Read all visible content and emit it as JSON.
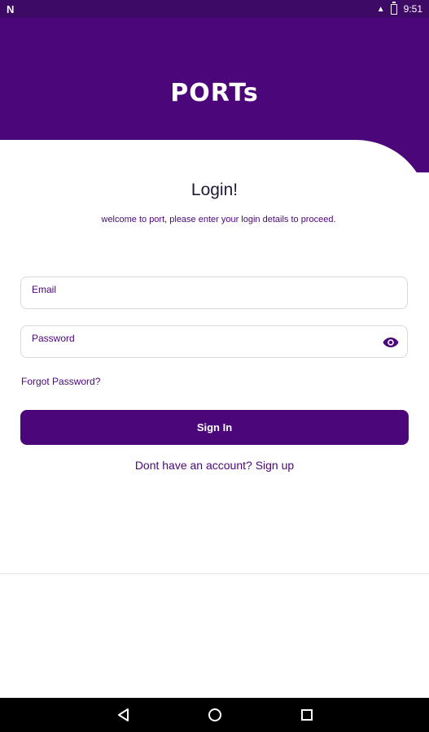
{
  "status_bar": {
    "left_icon": "N",
    "signal": "▲",
    "time": "9:51"
  },
  "header": {
    "logo_text": "PORTs"
  },
  "login": {
    "title": "Login!",
    "subtitle": "welcome to port, please enter your login details to proceed.",
    "email_placeholder": "Email",
    "password_placeholder": "Password",
    "forgot_password": "Forgot Password?",
    "signin_label": "Sign In",
    "signup_text": "Dont have an account? Sign up"
  },
  "navigation": {
    "back": "back-icon",
    "home": "home-icon",
    "recents": "recents-icon"
  },
  "colors": {
    "primary": "#4b067a",
    "status_bar": "#3d0a66",
    "title_text": "#1c1c3a",
    "border": "#d9d9d9"
  }
}
